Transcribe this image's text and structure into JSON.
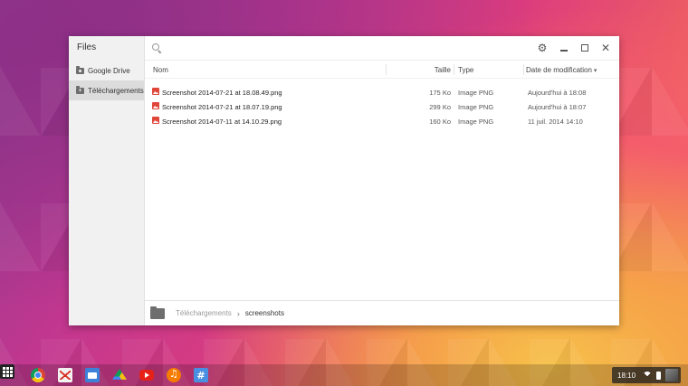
{
  "sidebar": {
    "title": "Files",
    "items": [
      {
        "label": "Google Drive",
        "icon": "drive-folder-icon"
      },
      {
        "label": "Téléchargements",
        "icon": "downloads-folder-icon"
      }
    ]
  },
  "columns": {
    "name": "Nom",
    "size": "Taille",
    "type": "Type",
    "date": "Date de modification"
  },
  "files": [
    {
      "name": "Screenshot 2014-07-21 at 18.08.49.png",
      "size": "175 Ko",
      "type": "Image PNG",
      "date": "Aujourd'hui à 18:08"
    },
    {
      "name": "Screenshot 2014-07-21 at 18.07.19.png",
      "size": "299 Ko",
      "type": "Image PNG",
      "date": "Aujourd'hui à 18:07"
    },
    {
      "name": "Screenshot 2014-07-11 at 14.10.29.png",
      "size": "160 Ko",
      "type": "Image PNG",
      "date": "11 juil. 2014 14:10"
    }
  ],
  "breadcrumb": {
    "parent": "Téléchargements",
    "separator": "›",
    "current": "screenshots"
  },
  "window_controls": {
    "settings_glyph": "⚙",
    "close_glyph": "✕"
  },
  "shelf": {
    "apps": [
      "app-launcher-icon",
      "chrome-icon",
      "gmail-icon",
      "files-app-icon",
      "google-drive-icon",
      "youtube-icon",
      "google-music-icon",
      "hashtag-app-icon"
    ],
    "hash_glyph": "#"
  },
  "tray": {
    "time": "18:10"
  }
}
